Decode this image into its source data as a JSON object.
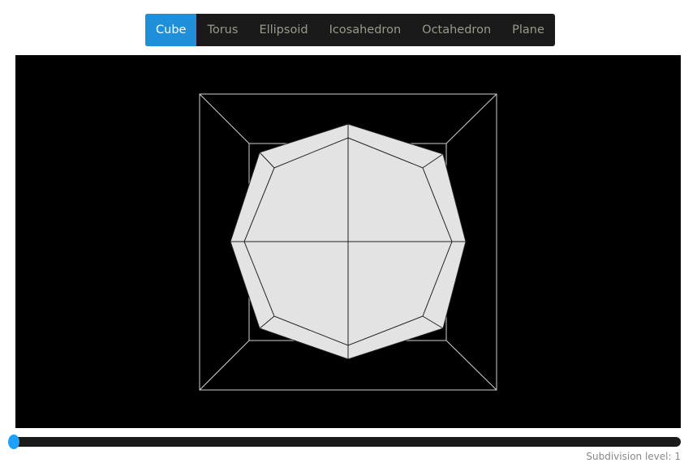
{
  "tabs": [
    {
      "label": "Cube",
      "active": true
    },
    {
      "label": "Torus"
    },
    {
      "label": "Ellipsoid"
    },
    {
      "label": "Icosahedron"
    },
    {
      "label": "Octahedron"
    },
    {
      "label": "Plane"
    }
  ],
  "slider": {
    "label_prefix": "Subdivision level:",
    "value": 1,
    "min_fraction": 0
  },
  "colors": {
    "accent": "#1e8fd8",
    "viewport_bg": "#000000",
    "mesh_fill": "#e3e3e3"
  }
}
